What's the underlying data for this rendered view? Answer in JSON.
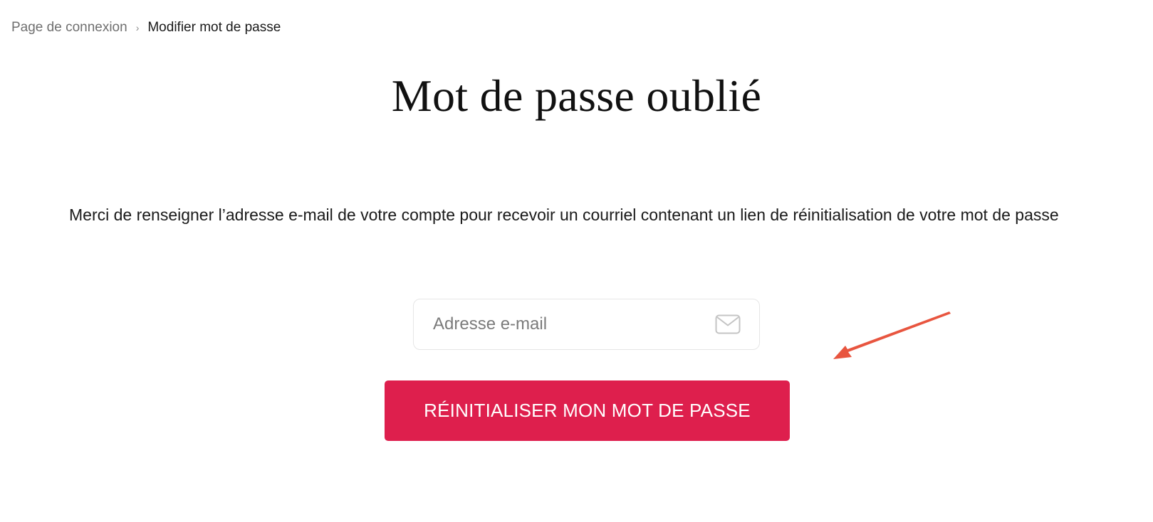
{
  "breadcrumb": {
    "parent": "Page de connexion",
    "separator": "›",
    "current": "Modifier mot de passe"
  },
  "page": {
    "title": "Mot de passe oublié",
    "instructions": "Merci de renseigner l’adresse e-mail de votre compte pour recevoir un courriel contenant un lien de réinitialisation de votre mot de passe"
  },
  "form": {
    "email": {
      "value": "",
      "placeholder": "Adresse e-mail",
      "icon": "envelope-icon"
    },
    "submit_label": "RÉINITIALISER MON MOT DE PASSE"
  },
  "colors": {
    "accent": "#de1f4d",
    "annotation": "#e8553f"
  }
}
